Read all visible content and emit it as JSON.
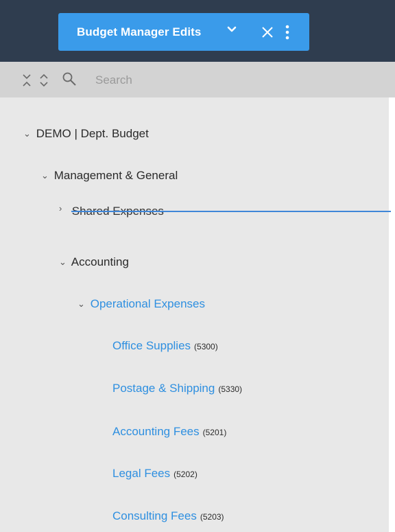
{
  "header": {
    "view_selector_label": "Budget Manager Edits",
    "icons": [
      "chevron-down-icon",
      "close-icon",
      "kebab-menu-icon"
    ]
  },
  "toolbar": {
    "icons": [
      "collapse-all-icon",
      "expand-all-icon",
      "search-icon"
    ],
    "search_placeholder": "Search"
  },
  "tree": {
    "root": {
      "label": "DEMO | Dept. Budget",
      "expanded": true
    },
    "management": {
      "label": "Management & General",
      "expanded": true
    },
    "shared": {
      "label": "Shared Expenses",
      "expanded": false,
      "state": "dragging"
    },
    "accounting": {
      "label": "Accounting",
      "expanded": true
    },
    "operational": {
      "label": "Operational Expenses",
      "expanded": true,
      "highlight": true
    },
    "accounts": [
      {
        "label": "Office Supplies",
        "code": "(5300)"
      },
      {
        "label": "Postage & Shipping",
        "code": "(5330)"
      },
      {
        "label": "Accounting Fees",
        "code": "(5201)"
      },
      {
        "label": "Legal Fees",
        "code": "(5202)"
      },
      {
        "label": "Consulting Fees",
        "code": "(5203)"
      }
    ]
  },
  "colors": {
    "header_bg": "#2f3d4f",
    "pill_bg": "#3a9bea",
    "toolbar_bg": "#d3d3d3",
    "tree_bg": "#e8e8e8",
    "link_blue": "#2e8fe0",
    "drop_indicator": "#3f86d8"
  }
}
